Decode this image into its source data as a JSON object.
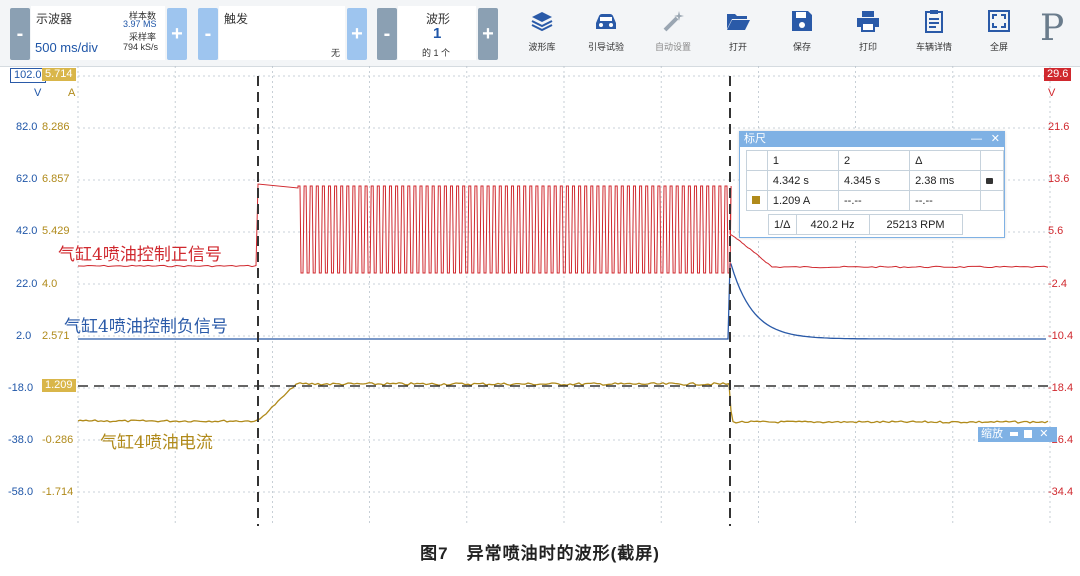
{
  "toolbar": {
    "scope": {
      "title": "示波器",
      "value": "500 ms/div",
      "sample_count_label": "样本数",
      "sample_count": "3.97 MS",
      "sample_rate_label": "采样率",
      "sample_rate": "794 kS/s"
    },
    "trigger": {
      "title": "触发",
      "mode": "无"
    },
    "waveform": {
      "title": "波形",
      "number": "1",
      "of_text": "的 1 个"
    },
    "minus_label": "-",
    "plus_label": "+",
    "tools": [
      {
        "label": "波形库",
        "icon": "waveform-library-icon",
        "disabled": false
      },
      {
        "label": "引导试验",
        "icon": "car-icon",
        "disabled": false
      },
      {
        "label": "自动设置",
        "icon": "magic-wand-icon",
        "disabled": true
      },
      {
        "label": "打开",
        "icon": "folder-open-icon",
        "disabled": false
      },
      {
        "label": "保存",
        "icon": "floppy-disk-icon",
        "disabled": false
      },
      {
        "label": "打印",
        "icon": "printer-icon",
        "disabled": false
      },
      {
        "label": "车辆详情",
        "icon": "clipboard-icon",
        "disabled": false
      },
      {
        "label": "全屏",
        "icon": "fullscreen-icon",
        "disabled": false
      }
    ],
    "logo": "P"
  },
  "axes": {
    "left_top_a": "102.0",
    "left_top_b": "5.714",
    "left_unit_a": "V",
    "left_unit_b": "A",
    "right_top": "29.6",
    "right_unit": "V",
    "left_ticks": [
      "82.0",
      "62.0",
      "42.0",
      "22.0",
      "2.0",
      "-18.0",
      "-38.0",
      "-58.0"
    ],
    "left2_ticks": [
      "8.286",
      "6.857",
      "5.429",
      "4.0",
      "2.571",
      "1.209",
      "-0.286",
      "-1.714"
    ],
    "right_ticks": [
      "21.6",
      "13.6",
      "5.6",
      "-2.4",
      "-10.4",
      "-18.4",
      "-26.4",
      "-34.4"
    ]
  },
  "labels": {
    "positive": "气缸4喷油控制正信号",
    "negative": "气缸4喷油控制负信号",
    "current": "气缸4喷油电流"
  },
  "colors": {
    "positive": "#d0282e",
    "negative": "#2a5aa8",
    "current": "#b08a1a",
    "accent": "#7fb1e4"
  },
  "ruler": {
    "title": "标尺",
    "h1": "1",
    "h2": "2",
    "h3": "Δ",
    "t1": "4.342 s",
    "t2": "4.345 s",
    "td": "2.38 ms",
    "a1": "1.209 A",
    "a2": "--.--",
    "ad": "--.--",
    "freq_label": "1/Δ",
    "freq": "420.2 Hz",
    "rpm": "25213 RPM"
  },
  "zoom": {
    "title": "缩放"
  },
  "caption": "图7　异常喷油时的波形(截屏)"
}
